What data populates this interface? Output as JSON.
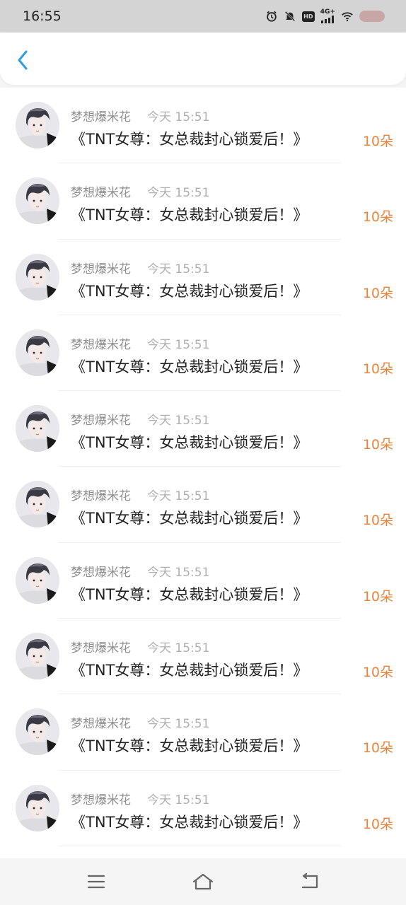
{
  "status_bar": {
    "time": "16:55",
    "icons": [
      "alarm-icon",
      "mute-icon",
      "hd-icon",
      "signal-4g-icon",
      "wifi-icon",
      "battery-icon"
    ],
    "network_label": "4G+",
    "hd_label": "HD"
  },
  "header": {
    "back_icon": "chevron-left-icon",
    "accent_color": "#2b9fe0"
  },
  "messages": [
    {
      "name": "梦想爆米花",
      "time": "今天 15:51",
      "text": "《TNT女尊：女总裁封心锁爱后！》",
      "count": "10朵"
    },
    {
      "name": "梦想爆米花",
      "time": "今天 15:51",
      "text": "《TNT女尊：女总裁封心锁爱后！》",
      "count": "10朵"
    },
    {
      "name": "梦想爆米花",
      "time": "今天 15:51",
      "text": "《TNT女尊：女总裁封心锁爱后！》",
      "count": "10朵"
    },
    {
      "name": "梦想爆米花",
      "time": "今天 15:51",
      "text": "《TNT女尊：女总裁封心锁爱后！》",
      "count": "10朵"
    },
    {
      "name": "梦想爆米花",
      "time": "今天 15:51",
      "text": "《TNT女尊：女总裁封心锁爱后！》",
      "count": "10朵"
    },
    {
      "name": "梦想爆米花",
      "time": "今天 15:51",
      "text": "《TNT女尊：女总裁封心锁爱后！》",
      "count": "10朵"
    },
    {
      "name": "梦想爆米花",
      "time": "今天 15:51",
      "text": "《TNT女尊：女总裁封心锁爱后！》",
      "count": "10朵"
    },
    {
      "name": "梦想爆米花",
      "time": "今天 15:51",
      "text": "《TNT女尊：女总裁封心锁爱后！》",
      "count": "10朵"
    },
    {
      "name": "梦想爆米花",
      "time": "今天 15:51",
      "text": "《TNT女尊：女总裁封心锁爱后！》",
      "count": "10朵"
    },
    {
      "name": "梦想爆米花",
      "time": "今天 15:51",
      "text": "《TNT女尊：女总裁封心锁爱后！》",
      "count": "10朵"
    }
  ],
  "count_color": "#e8843c",
  "nav_bar": {
    "icons": [
      "menu-icon",
      "home-icon",
      "back-icon"
    ]
  }
}
